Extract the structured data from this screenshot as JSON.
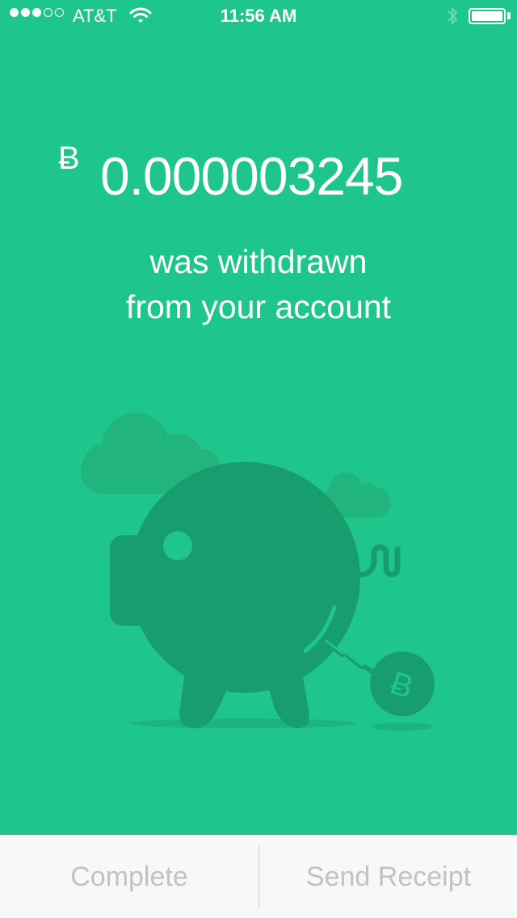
{
  "status_bar": {
    "carrier": "AT&T",
    "time": "11:56 AM",
    "signal_filled": 3,
    "signal_total": 5
  },
  "transaction": {
    "currency_symbol": "Ƀ",
    "amount": "0.000003245",
    "message_line1": "was withdrawn",
    "message_line2": "from your account"
  },
  "actions": {
    "complete_label": "Complete",
    "send_receipt_label": "Send Receipt"
  },
  "colors": {
    "background": "#1fc68c",
    "illustration_dark": "#189e6e",
    "cloud": "#22b47f",
    "bottom_bar": "#f8f8f8",
    "button_text": "#c2c2c2"
  },
  "icons": {
    "wifi": "wifi-icon",
    "bluetooth": "bluetooth-icon",
    "battery": "battery-icon",
    "illustration": "piggy-bank-illustration"
  }
}
